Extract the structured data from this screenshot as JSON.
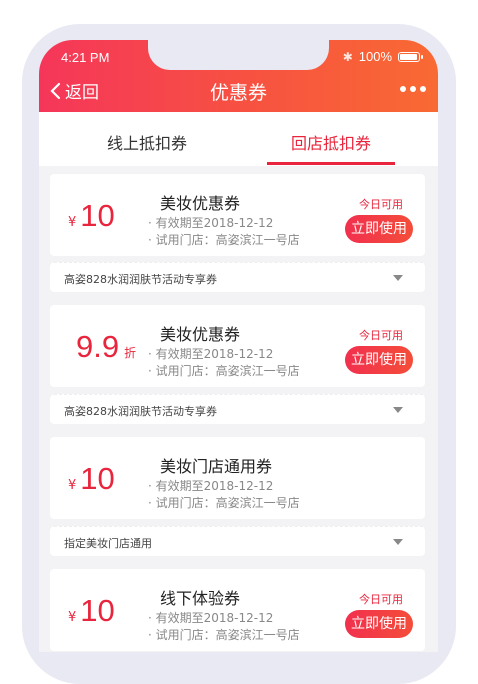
{
  "status": {
    "time": "4:21 PM",
    "battery": "100%",
    "battery_level": 1.0
  },
  "nav": {
    "back_label": "返回",
    "title": "优惠券"
  },
  "tabs": [
    {
      "label": "线上抵扣券"
    },
    {
      "label": "回店抵扣券",
      "active": true
    }
  ],
  "colors": {
    "accent": "#e8253c",
    "header_start": "#f5365a",
    "header_end": "#f96a33"
  },
  "coupons": [
    {
      "symbol": "¥",
      "amount": "10",
      "unit": "",
      "name": "美妆优惠券",
      "expiry": "· 有效期至2018-12-12",
      "store": "· 试用门店：高姿滨江一号店",
      "badge": "今日可用",
      "button": "立即使用",
      "footer": "高姿828水润润肤节活动专享券"
    },
    {
      "symbol": "",
      "amount": "9.9",
      "unit": "折",
      "name": "美妆优惠券",
      "expiry": "· 有效期至2018-12-12",
      "store": "· 试用门店：高姿滨江一号店",
      "badge": "今日可用",
      "button": "立即使用",
      "footer": "高姿828水润润肤节活动专享券"
    },
    {
      "symbol": "¥",
      "amount": "10",
      "unit": "",
      "name": "美妆门店通用券",
      "expiry": "· 有效期至2018-12-12",
      "store": "· 试用门店：高姿滨江一号店",
      "badge": "",
      "button": "",
      "footer": "指定美妆门店通用"
    },
    {
      "symbol": "¥",
      "amount": "10",
      "unit": "",
      "name": "线下体验券",
      "expiry": "· 有效期至2018-12-12",
      "store": "· 试用门店：高姿滨江一号店",
      "badge": "今日可用",
      "button": "立即使用",
      "footer": ""
    }
  ]
}
